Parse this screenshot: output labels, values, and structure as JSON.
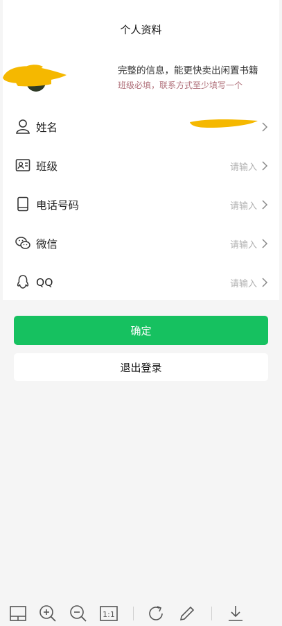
{
  "header": {
    "title": "个人资料"
  },
  "profile": {
    "info_main": "完整的信息，能更快卖出闲置书籍",
    "info_sub": "班级必填，联系方式至少填写一个"
  },
  "fields": [
    {
      "label": "姓名",
      "value": "",
      "icon": "user-icon"
    },
    {
      "label": "班级",
      "value": "请输入",
      "icon": "id-card-icon"
    },
    {
      "label": "电话号码",
      "value": "请输入",
      "icon": "phone-icon"
    },
    {
      "label": "微信",
      "value": "请输入",
      "icon": "wechat-icon"
    },
    {
      "label": "QQ",
      "value": "请输入",
      "icon": "qq-icon"
    }
  ],
  "actions": {
    "confirm": "确定",
    "logout": "退出登录"
  },
  "viewer_toolbar": {
    "icons": [
      "layout-icon",
      "zoom-in-icon",
      "zoom-out-icon",
      "actual-size-icon",
      "rotate-icon",
      "edit-icon",
      "download-icon"
    ],
    "actual_size_label": "1:1"
  },
  "colors": {
    "primary": "#16c160",
    "hint": "#b0707a",
    "placeholder": "#b0b0b0",
    "redaction": "#f5b800"
  }
}
